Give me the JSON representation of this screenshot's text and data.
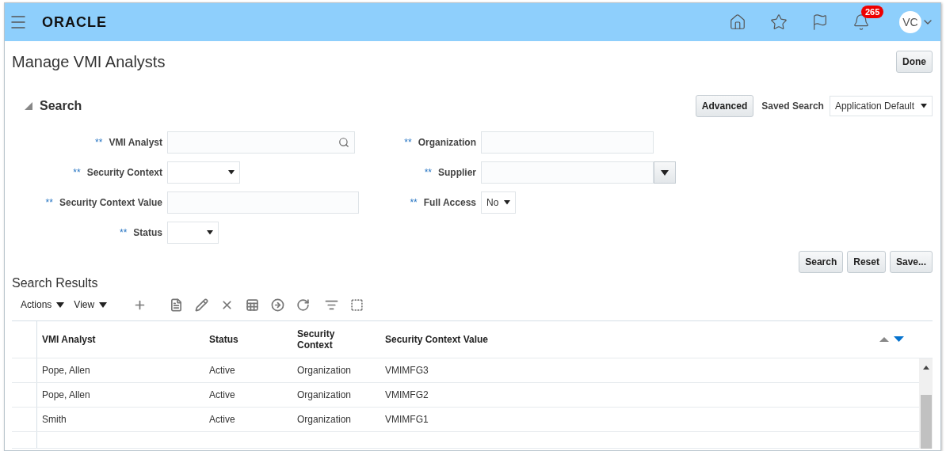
{
  "header": {
    "logo": "ORACLE",
    "notification_count": "265",
    "avatar": "VC"
  },
  "page": {
    "title": "Manage VMI Analysts",
    "done_button": "Done"
  },
  "search": {
    "title": "Search",
    "expanded": true,
    "advanced_button": "Advanced",
    "saved_search_label": "Saved Search",
    "saved_search_value": "Application Default",
    "left_fields": [
      {
        "label": "VMI Analyst",
        "required_mark": "**",
        "kind": "search"
      },
      {
        "label": "Security Context",
        "required_mark": "**",
        "kind": "select"
      },
      {
        "label": "Security Context Value",
        "required_mark": "**",
        "kind": "text"
      },
      {
        "label": "Status",
        "required_mark": "**",
        "kind": "select"
      }
    ],
    "right_fields": [
      {
        "label": "Organization",
        "required_mark": "**",
        "kind": "text"
      },
      {
        "label": "Supplier",
        "required_mark": "**",
        "kind": "combo"
      },
      {
        "label": "Full Access",
        "required_mark": "**",
        "kind": "select",
        "value": "No"
      }
    ],
    "buttons": [
      "Search",
      "Reset",
      "Save..."
    ]
  },
  "results": {
    "title": "Search Results",
    "menus": [
      "Actions",
      "View"
    ],
    "table": {
      "columns": [
        "VMI Analyst",
        "Status",
        "Security Context",
        "Security Context Value"
      ],
      "rows": [
        [
          "Pope, Allen",
          "Active",
          "Organization",
          "VMIMFG3"
        ],
        [
          "Pope, Allen",
          "Active",
          "Organization",
          "VMIMFG2"
        ],
        [
          "Smith",
          "Active",
          "Organization",
          "VMIMFG1"
        ]
      ]
    }
  }
}
